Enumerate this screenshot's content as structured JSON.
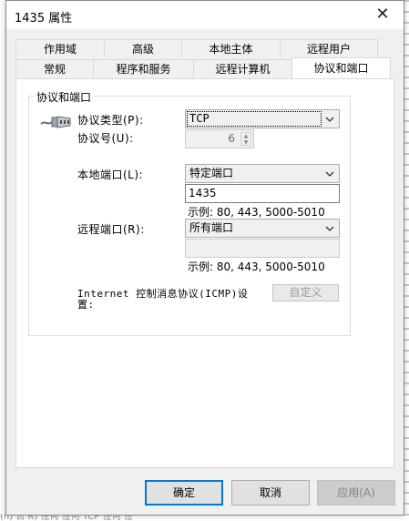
{
  "window": {
    "title": "1435 属性",
    "close_glyph": "✕"
  },
  "tabs": {
    "row1": [
      "作用域",
      "高级",
      "本地主体",
      "远程用户"
    ],
    "row2": [
      "常规",
      "程序和服务",
      "远程计算机",
      "协议和端口"
    ],
    "active": "协议和端口"
  },
  "group": {
    "title": "协议和端口",
    "protocol_type_label": "协议类型(P):",
    "protocol_type_value": "TCP",
    "protocol_number_label": "协议号(U):",
    "protocol_number_value": "6",
    "local_port_label": "本地端口(L):",
    "local_port_select": "特定端口",
    "local_port_value": "1435",
    "local_example": "示例: 80, 443, 5000-5010",
    "remote_port_label": "远程端口(R):",
    "remote_port_select": "所有端口",
    "remote_port_value": "",
    "remote_example": "示例: 80, 443, 5000-5010",
    "icmp_label_line1": "Internet 控制消息协议(ICMP)设",
    "icmp_label_line2": "置:",
    "customize_button": "自定义",
    "icon": "network-cable-icon"
  },
  "buttons": {
    "ok": "确定",
    "cancel": "取消",
    "apply": "应用(A)"
  },
  "background": {
    "bottom_text": "(n)     否     R)     任何     任何     TCP     任何     任"
  },
  "colors": {
    "window_bg": "#f0f0f0",
    "panel_bg": "#ffffff",
    "focus_border": "#0078d7",
    "disabled_text": "#838383"
  }
}
